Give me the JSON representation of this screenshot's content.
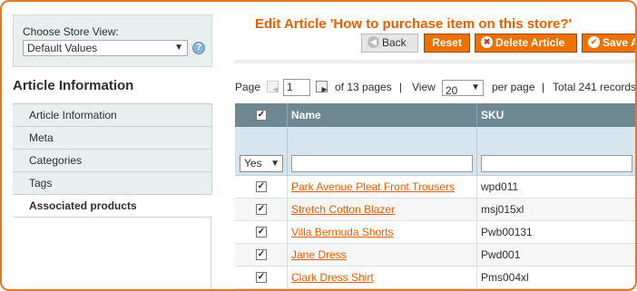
{
  "store_switcher": {
    "label": "Choose Store View:",
    "selected": "Default Values",
    "help_icon": "?"
  },
  "sidebar": {
    "title": "Article Information",
    "items": [
      {
        "label": "Article Information"
      },
      {
        "label": "Meta"
      },
      {
        "label": "Categories"
      },
      {
        "label": "Tags"
      },
      {
        "label": "Associated products",
        "active": true
      }
    ]
  },
  "header": {
    "title": "Edit Article 'How to purchase item on this store?'",
    "buttons": {
      "back": "Back",
      "reset": "Reset",
      "delete": "Delete Article",
      "save": "Save A"
    }
  },
  "pager": {
    "page_label": "Page",
    "current_page": "1",
    "of_pages": "of 13 pages",
    "sep1": "|",
    "view_label": "View",
    "per_page_value": "20",
    "per_page_label": "per page",
    "sep2": "|",
    "total": "Total 241 records"
  },
  "grid": {
    "columns": {
      "name": "Name",
      "sku": "SKU"
    },
    "filter": {
      "in_products": "Yes"
    },
    "rows": [
      {
        "checked": true,
        "name": "Park Avenue Pleat Front Trousers",
        "sku": "wpd011"
      },
      {
        "checked": true,
        "name": "Stretch Cotton Blazer",
        "sku": "msj015xl"
      },
      {
        "checked": true,
        "name": "Villa Bermuda Shorts",
        "sku": "Pwb00131"
      },
      {
        "checked": true,
        "name": "Jane Dress",
        "sku": "Pwd001"
      },
      {
        "checked": true,
        "name": "Clark Dress Shirt",
        "sku": "Pms004xl"
      }
    ]
  },
  "colors": {
    "accent": "#eb5e00",
    "button_orange": "#ec7200",
    "grid_header": "#6f8992",
    "filter_row": "#d7e5ef",
    "sidebar_tab": "#e7efef",
    "frame": "#e07a2a"
  },
  "icons": {
    "back": "arrow-left-icon",
    "delete": "delete-circle-icon",
    "save": "check-icon",
    "prev": "triangle-left-icon",
    "next": "triangle-right-icon",
    "dropdown": "chevron-down-icon",
    "checkbox": "checkmark-icon"
  }
}
